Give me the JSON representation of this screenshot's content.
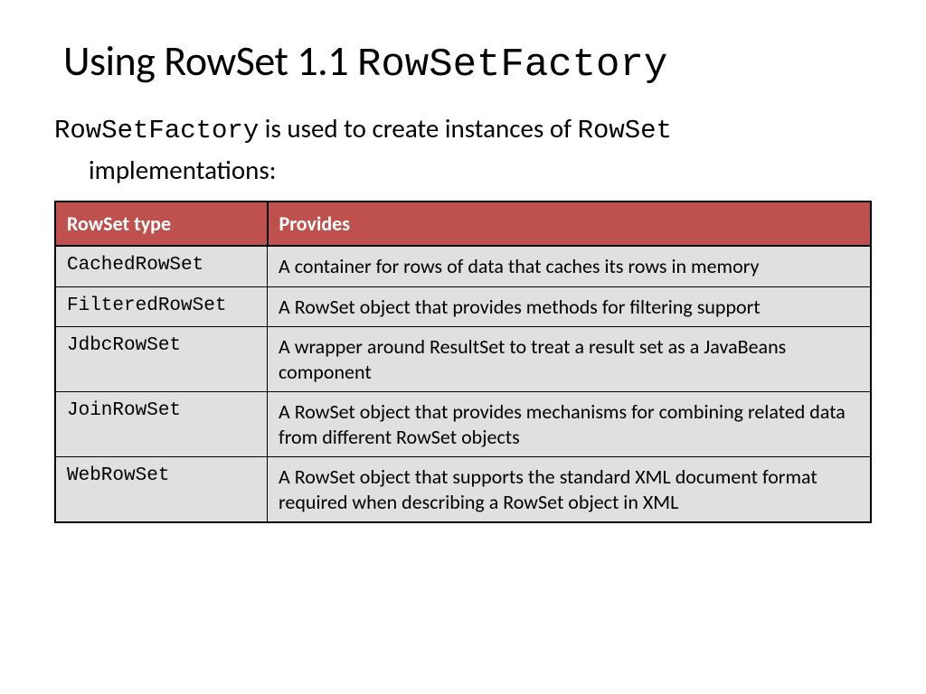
{
  "title": {
    "prefix": "Using RowSet 1.1 ",
    "mono": "RowSetFactory"
  },
  "subtitle": {
    "mono1": "RowSetFactory",
    "mid": " is used to create instances of ",
    "mono2": "RowSet",
    "line2": "implementations:"
  },
  "table": {
    "headers": {
      "type": "RowSet type",
      "provides": "Provides"
    },
    "rows": [
      {
        "type": "CachedRowSet",
        "desc": "A container for rows of data that caches its rows in memory"
      },
      {
        "type": "FilteredRowSet",
        "desc": "A RowSet object that provides methods for filtering support"
      },
      {
        "type": "JdbcRowSet",
        "desc": "A wrapper around ResultSet to treat a result set as a JavaBeans component"
      },
      {
        "type": "JoinRowSet",
        "desc": "A RowSet object that provides mechanisms for combining related data from different RowSet objects"
      },
      {
        "type": "WebRowSet",
        "desc": "A RowSet object that supports the standard XML document format required when describing a RowSet object in XML"
      }
    ]
  }
}
